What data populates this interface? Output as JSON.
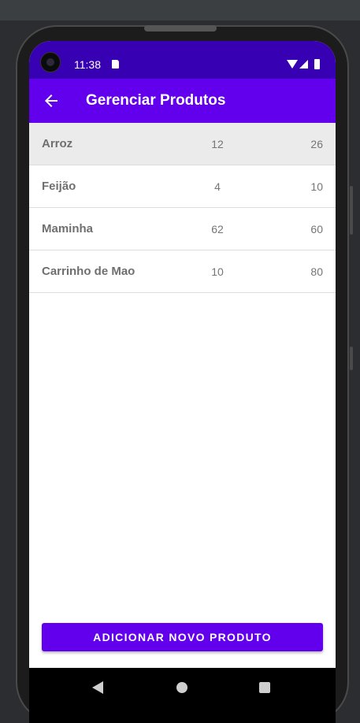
{
  "status_bar": {
    "time": "11:38"
  },
  "app_bar": {
    "title": "Gerenciar Produtos",
    "back_icon": "arrow-back-icon"
  },
  "products": [
    {
      "name": "Arroz",
      "quantity": "12",
      "price": "26",
      "selected": true
    },
    {
      "name": "Feijão",
      "quantity": "4",
      "price": "10",
      "selected": false
    },
    {
      "name": "Maminha",
      "quantity": "62",
      "price": "60",
      "selected": false
    },
    {
      "name": "Carrinho de Mao",
      "quantity": "10",
      "price": "80",
      "selected": false
    }
  ],
  "add_button": {
    "label": "ADICIONAR NOVO PRODUTO"
  },
  "colors": {
    "status_bar": "#3700b3",
    "primary": "#6200ee",
    "selected_row": "#ebebeb"
  }
}
